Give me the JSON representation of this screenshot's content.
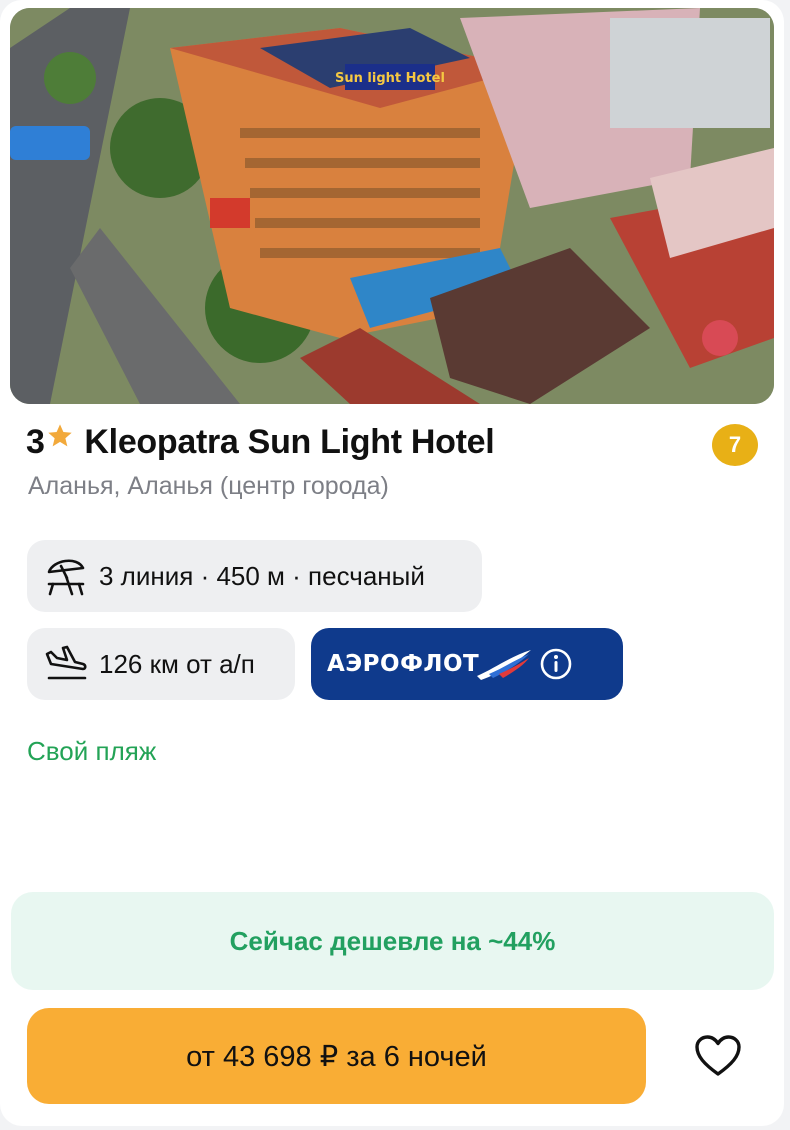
{
  "hotel": {
    "stars": "3",
    "name": "Kleopatra Sun Light Hotel",
    "rating": "7",
    "location": "Аланья, Аланья (центр города)",
    "photo_sign": "Sun light Hotel"
  },
  "features": {
    "beach": "3 линия · 450 м · песчаный",
    "airport": "126 км от а/п",
    "airline": "АЭРОФЛОТ",
    "own_beach": "Свой пляж"
  },
  "offer": {
    "discount": "Сейчас дешевле на ~44%",
    "price_label": "от 43 698 ₽ за 6 ночей"
  },
  "icons": {
    "star": "star-icon",
    "beach": "beach-umbrella-icon",
    "airport": "plane-landing-icon",
    "info": "info-icon",
    "favorite": "heart-icon"
  },
  "colors": {
    "star": "#f2a93b",
    "rating_badge": "#e8b016",
    "aeroflot_bg": "#0f3a8c",
    "green_text": "#23a356",
    "discount_bg": "#e8f7f1",
    "price_button": "#f9ad35"
  }
}
